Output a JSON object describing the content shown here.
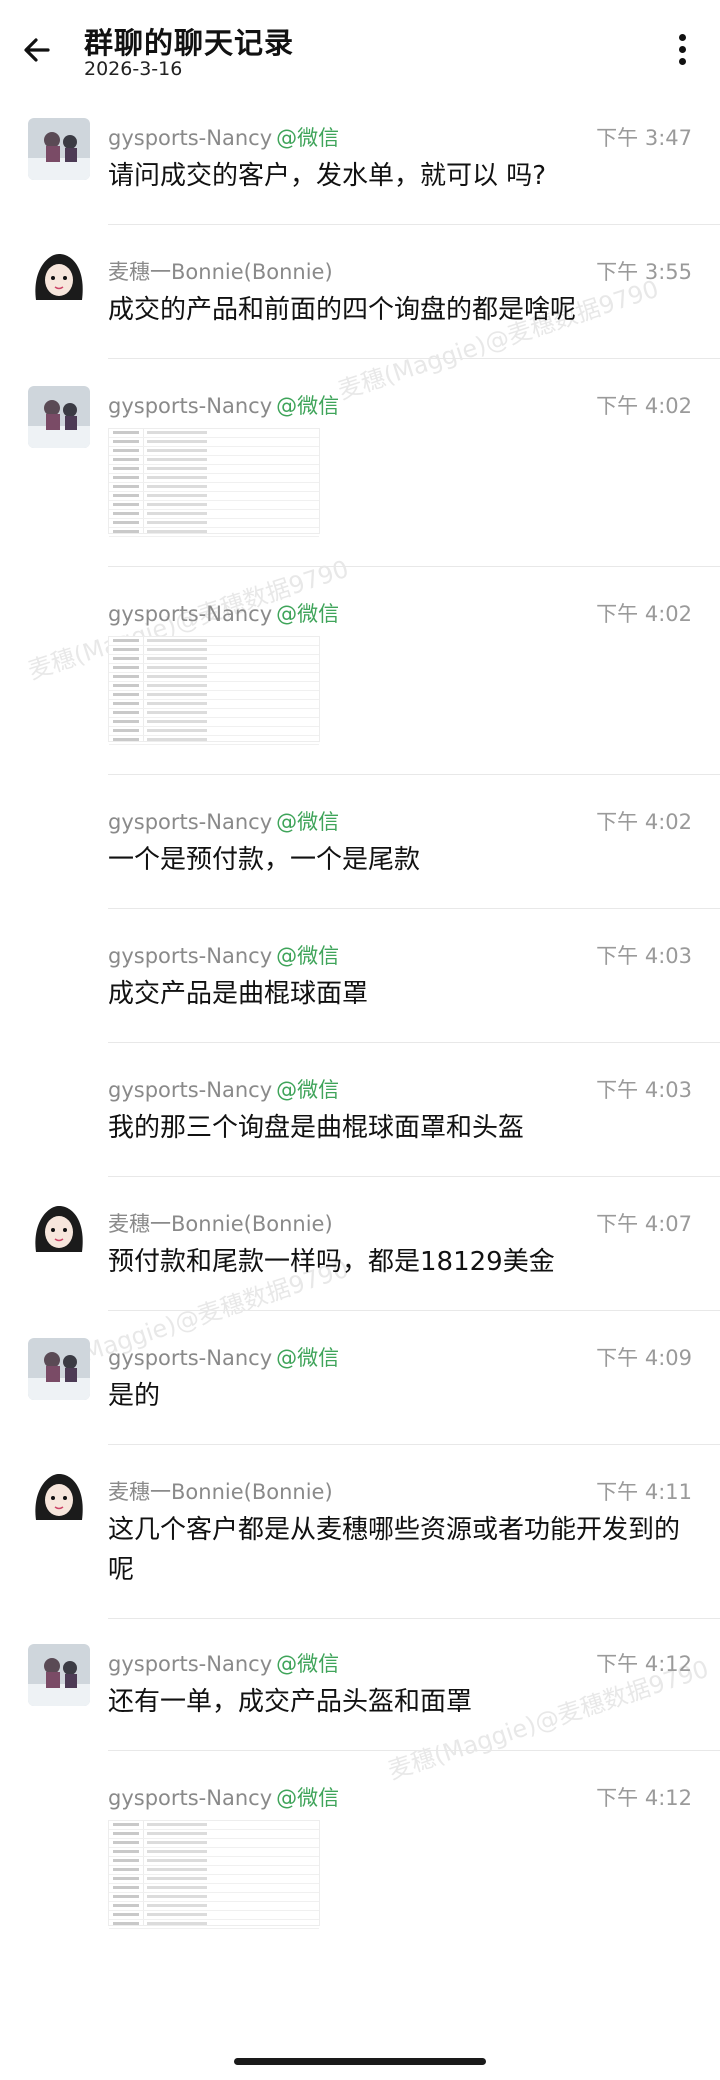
{
  "header": {
    "title": "群聊的聊天记录",
    "date": "2026-3-16"
  },
  "messages": [
    {
      "sender": "gysports-Nancy",
      "tag": "@微信",
      "time": "下午 3:47",
      "text": "请问成交的客户，发水单，就可以           吗?",
      "avatar": "nancy"
    },
    {
      "sender": "麦穗一Bonnie(Bonnie)",
      "tag": "",
      "time": "下午 3:55",
      "text": "成交的产品和前面的四个询盘的都是啥呢",
      "avatar": "bonnie"
    },
    {
      "sender": "gysports-Nancy",
      "tag": "@微信",
      "time": "下午 4:02",
      "text": "",
      "avatar": "nancy",
      "image": true
    },
    {
      "sender": "gysports-Nancy",
      "tag": "@微信",
      "time": "下午 4:02",
      "text": "",
      "avatar": "",
      "image": true
    },
    {
      "sender": "gysports-Nancy",
      "tag": "@微信",
      "time": "下午 4:02",
      "text": "一个是预付款，一个是尾款",
      "avatar": ""
    },
    {
      "sender": "gysports-Nancy",
      "tag": "@微信",
      "time": "下午 4:03",
      "text": "成交产品是曲棍球面罩",
      "avatar": ""
    },
    {
      "sender": "gysports-Nancy",
      "tag": "@微信",
      "time": "下午 4:03",
      "text": "我的那三个询盘是曲棍球面罩和头盔",
      "avatar": ""
    },
    {
      "sender": "麦穗一Bonnie(Bonnie)",
      "tag": "",
      "time": "下午 4:07",
      "text": "预付款和尾款一样吗，都是18129美金",
      "avatar": "bonnie"
    },
    {
      "sender": "gysports-Nancy",
      "tag": "@微信",
      "time": "下午 4:09",
      "text": "是的",
      "avatar": "nancy"
    },
    {
      "sender": "麦穗一Bonnie(Bonnie)",
      "tag": "",
      "time": "下午 4:11",
      "text": "这几个客户都是从麦穗哪些资源或者功能开发到的呢",
      "avatar": "bonnie"
    },
    {
      "sender": "gysports-Nancy",
      "tag": "@微信",
      "time": "下午 4:12",
      "text": "还有一单，成交产品头盔和面罩",
      "avatar": "nancy"
    },
    {
      "sender": "gysports-Nancy",
      "tag": "@微信",
      "time": "下午 4:12",
      "text": "",
      "avatar": "",
      "image": true
    }
  ],
  "colors": {
    "tag": "#3fa45a",
    "meta": "#8a8a8a",
    "divider": "#e8e8e8"
  },
  "icons": {
    "back": "arrow-left-icon",
    "more": "more-vertical-icon"
  }
}
